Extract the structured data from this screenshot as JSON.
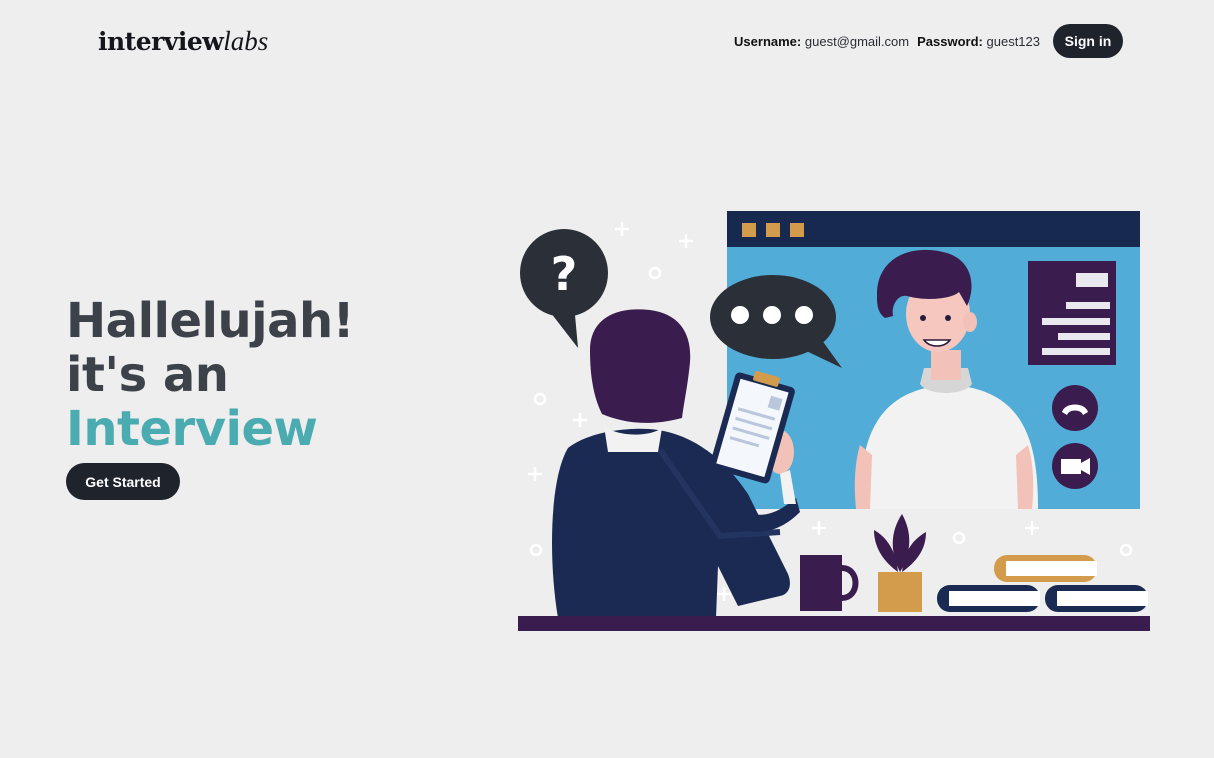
{
  "header": {
    "logo_bold": "interview",
    "logo_italic": "labs",
    "username_label": "Username:",
    "username_value": "guest@gmail.com",
    "password_label": "Password:",
    "password_value": "guest123",
    "signin_label": "Sign in"
  },
  "hero": {
    "line1": "Hallelujah!",
    "line2": "it's an",
    "line3": "Interview",
    "cta_label": "Get Started"
  },
  "illustration": {
    "question_mark": "?",
    "icons": [
      "question-bubble-icon",
      "typing-bubble-icon",
      "phone-icon",
      "video-camera-icon",
      "mug-icon",
      "plant-icon",
      "books-icon"
    ]
  },
  "colors": {
    "background": "#eeeeee",
    "button": "#1f232c",
    "heading": "#3d4149",
    "accent_teal": "#4aabb1",
    "navy": "#1a2a52",
    "screen_blue": "#52acd8",
    "purple": "#3a1d4e",
    "gold": "#d39b4c"
  }
}
